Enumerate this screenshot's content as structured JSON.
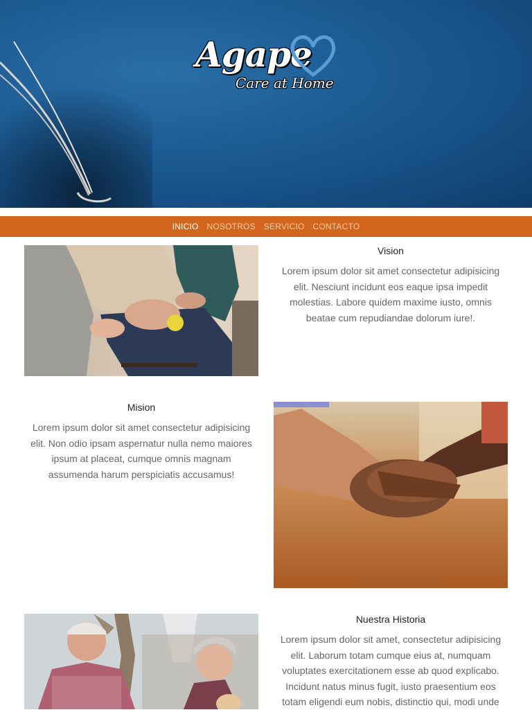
{
  "brand": {
    "name": "Agape",
    "tagline": "Care at Home",
    "heart_color": "#5b9bd5"
  },
  "hero": {
    "background_color": "#1d5c94"
  },
  "nav": {
    "background_color": "#d2661f",
    "items": [
      {
        "label": "INICIO",
        "active": true
      },
      {
        "label": "NOSOTROS",
        "active": false
      },
      {
        "label": "SERVICIO",
        "active": false
      },
      {
        "label": "CONTACTO",
        "active": false
      }
    ]
  },
  "sections": {
    "vision": {
      "title": "Vision",
      "text": "Lorem ipsum dolor sit amet consectetur adipisicing elit. Nesciunt incidunt eos eaque ipsa impedit molestias. Labore quidem maxime iusto, omnis beatae cum repudiandae dolorum iure!.",
      "image": "seniors-holding-hands-photo"
    },
    "mision": {
      "title": "Mision",
      "text": "Lorem ipsum dolor sit amet consectetur adipisicing elit. Non odio ipsam aspernatur nulla nemo maiores ipsum at placeat, cumque omnis magnam assumenda harum perspiciatis accusamus!",
      "image": "clasped-hands-photo"
    },
    "historia": {
      "title": "Nuestra Historia",
      "text": "Lorem ipsum dolor sit amet, consectetur adipisicing elit. Laborum totam cumque eius at, numquam voluptates exercitationem esse ab quod explicabo. Incidunt natus minus fugit, iusto praesentium eos totam eligendi eum nobis, distinctio qui, modi unde",
      "image": "elderly-couple-photo"
    }
  }
}
